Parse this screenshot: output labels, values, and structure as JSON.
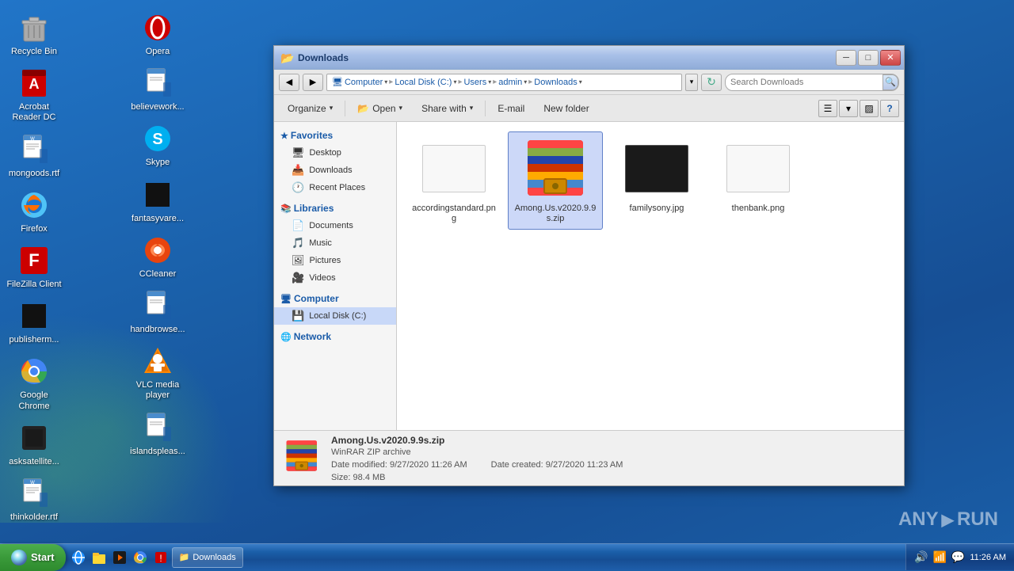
{
  "desktop": {
    "background_color": "#1a5fa8",
    "icons": [
      {
        "id": "recycle-bin",
        "label": "Recycle Bin",
        "icon": "🗑️",
        "type": "system"
      },
      {
        "id": "acrobat",
        "label": "Acrobat Reader DC",
        "icon": "📄",
        "type": "app"
      },
      {
        "id": "mongoods",
        "label": "mongoods.rtf",
        "icon": "📝",
        "type": "file"
      },
      {
        "id": "firefox",
        "label": "Firefox",
        "icon": "🦊",
        "type": "app"
      },
      {
        "id": "filezilla",
        "label": "FileZilla Client",
        "icon": "📁",
        "type": "app"
      },
      {
        "id": "publisherm",
        "label": "publisherm...",
        "icon": "⬛",
        "type": "file"
      },
      {
        "id": "chrome",
        "label": "Google Chrome",
        "icon": "🌐",
        "type": "app"
      },
      {
        "id": "asksatellite",
        "label": "asksatellite...",
        "icon": "📡",
        "type": "app"
      },
      {
        "id": "thinkolder",
        "label": "thinkolder.rtf",
        "icon": "📝",
        "type": "file"
      },
      {
        "id": "opera",
        "label": "Opera",
        "icon": "🅾️",
        "type": "app"
      },
      {
        "id": "believework",
        "label": "believework...",
        "icon": "📝",
        "type": "file"
      },
      {
        "id": "skype",
        "label": "Skype",
        "icon": "💬",
        "type": "app"
      },
      {
        "id": "fantasyvare",
        "label": "fantasyvare...",
        "icon": "⬛",
        "type": "file"
      },
      {
        "id": "ccleaner",
        "label": "CCleaner",
        "icon": "🔧",
        "type": "app"
      },
      {
        "id": "handbrowse",
        "label": "handbrowse...",
        "icon": "📝",
        "type": "file"
      },
      {
        "id": "vlc",
        "label": "VLC media player",
        "icon": "🎬",
        "type": "app"
      },
      {
        "id": "islandspleas",
        "label": "islandspleas...",
        "icon": "📝",
        "type": "file"
      }
    ]
  },
  "explorer": {
    "title": "Downloads",
    "title_icon": "📂",
    "window_buttons": {
      "minimize": "─",
      "maximize": "□",
      "close": "✕"
    },
    "breadcrumb": [
      {
        "label": "Computer",
        "hasDropdown": true
      },
      {
        "label": "Local Disk (C:)",
        "hasDropdown": true
      },
      {
        "label": "Users",
        "hasDropdown": true
      },
      {
        "label": "admin",
        "hasDropdown": true
      },
      {
        "label": "Downloads",
        "hasDropdown": true
      }
    ],
    "search_placeholder": "Search Downloads",
    "toolbar": {
      "organize": "Organize",
      "open": "Open",
      "share_with": "Share with",
      "email": "E-mail",
      "new_folder": "New folder"
    },
    "nav_pane": {
      "favorites": {
        "header": "Favorites",
        "items": [
          {
            "label": "Desktop",
            "icon": "🖥️"
          },
          {
            "label": "Downloads",
            "icon": "📥"
          },
          {
            "label": "Recent Places",
            "icon": "🕐"
          }
        ]
      },
      "libraries": {
        "header": "Libraries",
        "items": [
          {
            "label": "Documents",
            "icon": "📄"
          },
          {
            "label": "Music",
            "icon": "🎵"
          },
          {
            "label": "Pictures",
            "icon": "🖼️"
          },
          {
            "label": "Videos",
            "icon": "🎥"
          }
        ]
      },
      "computer": {
        "header": "Computer",
        "items": [
          {
            "label": "Local Disk (C:)",
            "icon": "💾",
            "active": true
          }
        ]
      },
      "network": {
        "header": "Network"
      }
    },
    "files": [
      {
        "id": "accordingstandard",
        "name": "accordingstandard.png",
        "type": "png",
        "thumb": "blank"
      },
      {
        "id": "among-us-zip",
        "name": "Among.Us.v2020.9.9s.zip",
        "type": "zip",
        "selected": true
      },
      {
        "id": "familysony",
        "name": "familysony.jpg",
        "type": "jpg",
        "thumb": "dark"
      },
      {
        "id": "thenbank",
        "name": "thenbank.png",
        "type": "png",
        "thumb": "light"
      }
    ],
    "status_bar": {
      "filename": "Among.Us.v2020.9.9s.zip",
      "date_modified_label": "Date modified:",
      "date_modified": "9/27/2020 11:26 AM",
      "date_created_label": "Date created:",
      "date_created": "9/27/2020 11:23 AM",
      "type": "WinRAR ZIP archive",
      "size_label": "Size:",
      "size": "98.4 MB"
    }
  },
  "taskbar": {
    "start_label": "Start",
    "items": [
      {
        "label": "Downloads",
        "icon": "📁"
      }
    ],
    "tray": {
      "time": "11:26 AM"
    }
  },
  "watermark": {
    "text": "ANY ▶ RUN"
  }
}
